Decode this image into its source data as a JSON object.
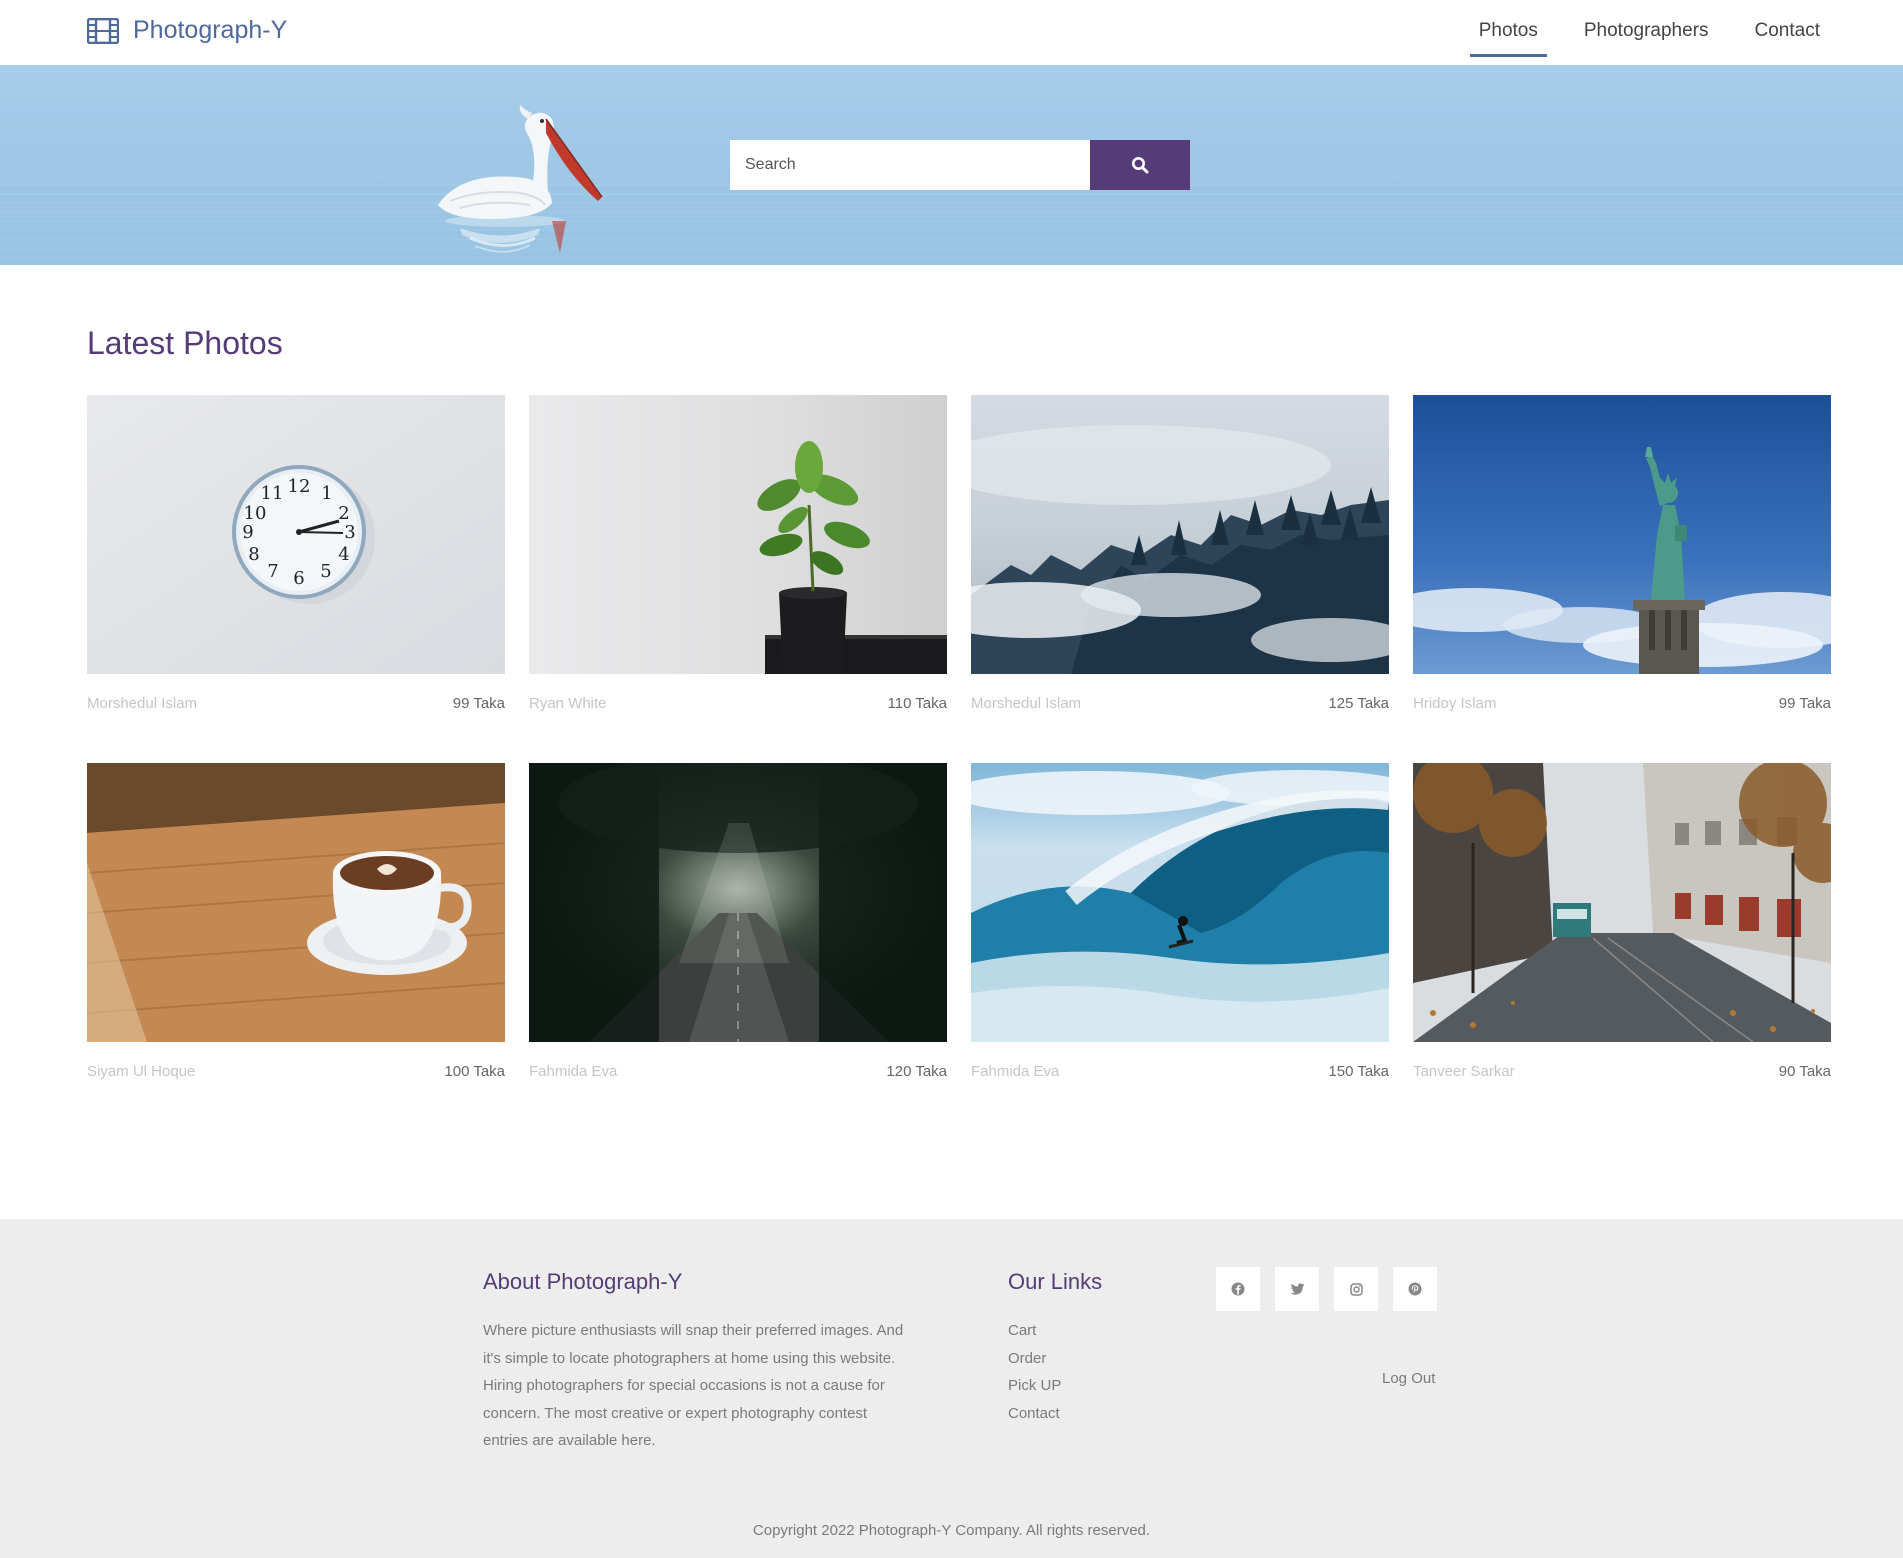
{
  "brand": {
    "name": "Photograph-Y",
    "icon": "film-icon",
    "color": "#4e6a9c"
  },
  "nav": {
    "items": [
      {
        "label": "Photos",
        "active": true
      },
      {
        "label": "Photographers",
        "active": false
      },
      {
        "label": "Contact",
        "active": false
      }
    ]
  },
  "search": {
    "placeholder": "Search",
    "button_icon": "search-icon",
    "button_color": "#553b78"
  },
  "latest": {
    "title": "Latest Photos",
    "photos": [
      {
        "subject": "wall clock",
        "author": "Morshedul Islam",
        "price": "99 Taka"
      },
      {
        "subject": "potted plant",
        "author": "Ryan White",
        "price": "110 Taka"
      },
      {
        "subject": "misty forest",
        "author": "Morshedul Islam",
        "price": "125 Taka"
      },
      {
        "subject": "statue of liberty",
        "author": "Hridoy Islam",
        "price": "99 Taka"
      },
      {
        "subject": "coffee cup",
        "author": "Siyam Ul Hoque",
        "price": "100 Taka"
      },
      {
        "subject": "forest road",
        "author": "Fahmida Eva",
        "price": "120 Taka"
      },
      {
        "subject": "surfing wave",
        "author": "Fahmida Eva",
        "price": "150 Taka"
      },
      {
        "subject": "tram street",
        "author": "Tanveer Sarkar",
        "price": "90 Taka"
      }
    ]
  },
  "footer": {
    "about_title": "About Photograph-Y",
    "about_text": "Where picture enthusiasts will snap their preferred images. And it's simple to locate photographers at home using this website. Hiring photographers for special occasions is not a cause for concern. The most creative or expert photography contest entries are available here.",
    "links_title": "Our Links",
    "links": [
      "Cart",
      "Order",
      "Pick UP",
      "Contact"
    ],
    "social": [
      "facebook-icon",
      "twitter-icon",
      "instagram-icon",
      "pinterest-icon"
    ],
    "logout": "Log Out",
    "copyright": "Copyright 2022 Photograph-Y Company. All rights reserved."
  },
  "colors": {
    "accent": "#553b78",
    "brand": "#4e6a9c",
    "footer_bg": "#ededed",
    "hero_sky": "#a7cdea"
  }
}
